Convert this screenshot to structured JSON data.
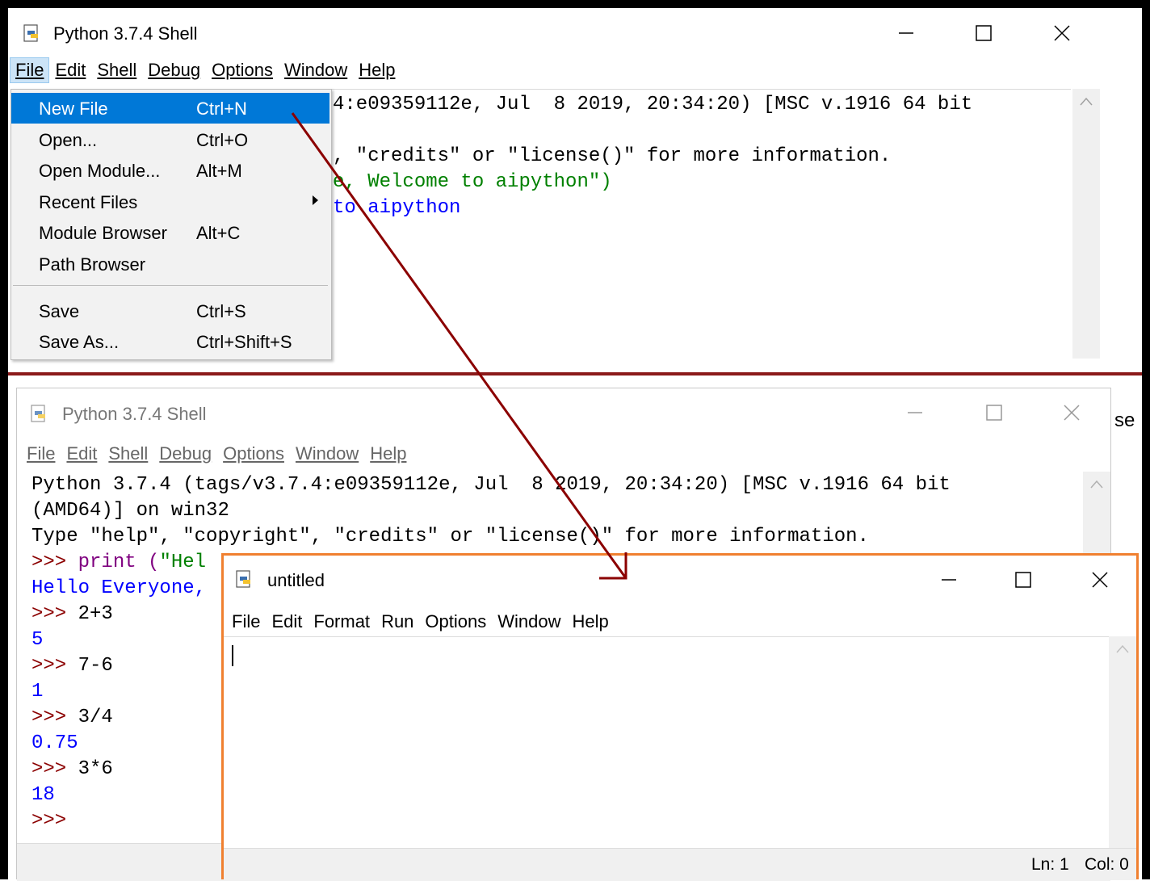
{
  "top_window": {
    "title": "Python 3.7.4 Shell",
    "menu": [
      "File",
      "Edit",
      "Shell",
      "Debug",
      "Options",
      "Window",
      "Help"
    ],
    "file_menu": {
      "items": [
        {
          "label": "New File",
          "shortcut": "Ctrl+N",
          "selected": true
        },
        {
          "label": "Open...",
          "shortcut": "Ctrl+O"
        },
        {
          "label": "Open Module...",
          "shortcut": "Alt+M"
        },
        {
          "label": "Recent Files",
          "shortcut": "",
          "submenu": true
        },
        {
          "label": "Module Browser",
          "shortcut": "Alt+C"
        },
        {
          "label": "Path Browser",
          "shortcut": ""
        },
        {
          "label": "Save",
          "shortcut": "Ctrl+S"
        },
        {
          "label": "Save As...",
          "shortcut": "Ctrl+Shift+S"
        }
      ]
    },
    "visible_text": {
      "line1": "4:e09359112e, Jul  8 2019, 20:34:20) [MSC v.1916 64 bit",
      "line3": ", \"credits\" or \"license()\" for more information.",
      "line4": "e, Welcome to aipython\")",
      "line5": "to aipython"
    }
  },
  "bottom_window": {
    "title": "Python 3.7.4 Shell",
    "menu": [
      "File",
      "Edit",
      "Shell",
      "Debug",
      "Options",
      "Window",
      "Help"
    ],
    "lines": {
      "l1": "Python 3.7.4 (tags/v3.7.4:e09359112e, Jul  8 2019, 20:34:20) [MSC v.1916 64 bit",
      "l2": "(AMD64)] on win32",
      "l3": "Type \"help\", \"copyright\", \"credits\" or \"license()\" for more information.",
      "l4_prompt": ">>> ",
      "l4_code": "print (",
      "l4_string": "\"Hel",
      "l5": "Hello Everyone,",
      "prompt": ">>> ",
      "cmd1": "2+3",
      "out1": "5",
      "cmd2": "7-6",
      "out2": "1",
      "cmd3": "3/4",
      "out3": "0.75",
      "cmd4": "3*6",
      "out4": "18",
      "last_prompt": ">>>"
    },
    "peek_text": "se"
  },
  "editor_window": {
    "title": "untitled",
    "menu": [
      "File",
      "Edit",
      "Format",
      "Run",
      "Options",
      "Window",
      "Help"
    ],
    "status": {
      "ln": "Ln: 1",
      "col": "Col: 0"
    }
  },
  "colors": {
    "selection": "#0078d7",
    "editor_border": "#f08030",
    "divider": "#8b1a1a",
    "arrow": "#8b0000",
    "prompt": "#8b0000",
    "output": "#0000ff",
    "string": "#008000",
    "builtin": "#800080"
  }
}
